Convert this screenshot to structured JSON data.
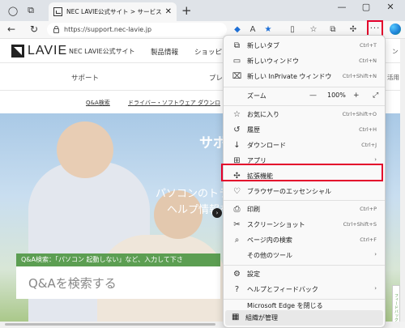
{
  "browser": {
    "tab_title": "NEC LAVIE公式サイト > サービス&サ",
    "tab_close": "✕",
    "new_tab": "+",
    "url": "https://support.nec-lavie.jp",
    "more_button": "···",
    "window_controls": [
      "—",
      "▢",
      "✕"
    ]
  },
  "site": {
    "logo_text": "LAVIE",
    "site_name": "NEC LAVIE公式サイト",
    "gnav": [
      "製品情報",
      "ショッピ"
    ],
    "subnav": [
      "サポート",
      "プレ"
    ],
    "links": [
      "Q&A検索",
      "ドライバー・ソフトウェア ダウンロ"
    ],
    "right_edge_labels": [
      "ン",
      "活用"
    ],
    "hero_title": "サポ",
    "hero_line1": "パソコンのトラブル",
    "hero_line2": "ヘルプ情報を",
    "qa_hint": "Q&A検索：「パソコン 起動しない」など、入力して下さ",
    "qa_placeholder": "Q&Aを検索する",
    "feedback": "フィードバック"
  },
  "menu": {
    "items": [
      {
        "label": "新しいタブ",
        "shortcut": "Ctrl+T",
        "icon": "new-tab-icon",
        "glyph": "⧉"
      },
      {
        "label": "新しいウィンドウ",
        "shortcut": "Ctrl+N",
        "icon": "new-window-icon",
        "glyph": "▭"
      },
      {
        "label": "新しい InPrivate ウィンドウ",
        "shortcut": "Ctrl+Shift+N",
        "icon": "inprivate-icon",
        "glyph": "⌧"
      },
      {
        "label": "お気に入り",
        "shortcut": "Ctrl+Shift+O",
        "icon": "favorites-icon",
        "glyph": "☆"
      },
      {
        "label": "履歴",
        "shortcut": "Ctrl+H",
        "icon": "history-icon",
        "glyph": "↺"
      },
      {
        "label": "ダウンロード",
        "shortcut": "Ctrl+J",
        "icon": "download-icon",
        "glyph": "↓"
      },
      {
        "label": "アプリ",
        "shortcut": "",
        "icon": "apps-icon",
        "glyph": "⊞"
      },
      {
        "label": "拡張機能",
        "shortcut": "",
        "icon": "extensions-icon",
        "glyph": "✣"
      },
      {
        "label": "ブラウザーのエッセンシャル",
        "shortcut": "",
        "icon": "essentials-icon",
        "glyph": "♡"
      },
      {
        "label": "印刷",
        "shortcut": "Ctrl+P",
        "icon": "print-icon",
        "glyph": "⎙"
      },
      {
        "label": "スクリーンショット",
        "shortcut": "Ctrl+Shift+S",
        "icon": "screenshot-icon",
        "glyph": "✂"
      },
      {
        "label": "ページ内の検索",
        "shortcut": "Ctrl+F",
        "icon": "find-icon",
        "glyph": "⌕"
      },
      {
        "label": "その他のツール",
        "shortcut": "",
        "icon": "",
        "glyph": ""
      },
      {
        "label": "設定",
        "shortcut": "",
        "icon": "settings-icon",
        "glyph": "⚙"
      },
      {
        "label": "ヘルプとフィードバック",
        "shortcut": "",
        "icon": "help-icon",
        "glyph": "?"
      },
      {
        "label": "Microsoft Edge を閉じる",
        "shortcut": "",
        "icon": "",
        "glyph": ""
      },
      {
        "label": "組織が管理",
        "shortcut": "",
        "icon": "managed-icon",
        "glyph": "▦"
      }
    ],
    "zoom": {
      "label": "ズーム",
      "minus": "—",
      "value": "100%",
      "plus": "+",
      "fullscreen": "⤢"
    },
    "arrow": "›"
  }
}
